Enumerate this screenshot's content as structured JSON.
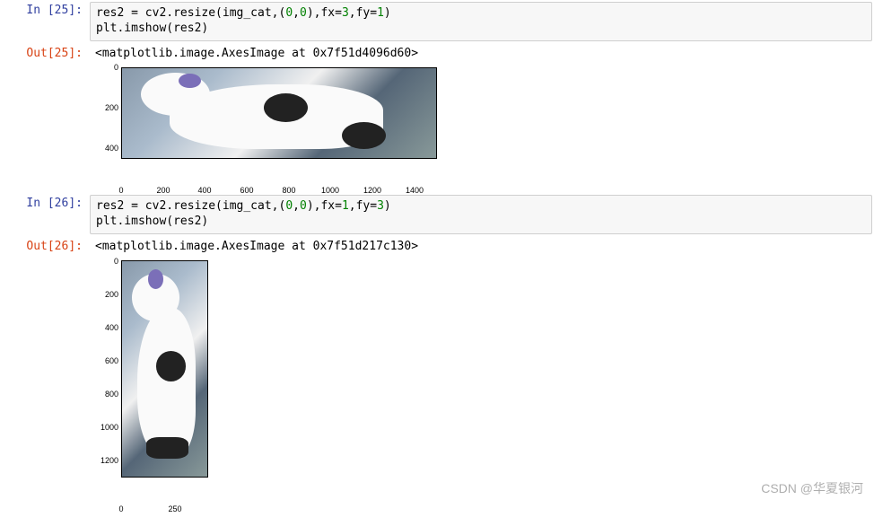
{
  "cells": {
    "c25": {
      "in_prompt": "In [25]:",
      "code_line1_prefix": "res2 = cv2.resize(img_cat,(",
      "code_line1_z1": "0",
      "code_line1_c1": ",",
      "code_line1_z2": "0",
      "code_line1_c2": "),fx=",
      "code_line1_fx": "3",
      "code_line1_c3": ",fy=",
      "code_line1_fy": "1",
      "code_line1_end": ")",
      "code_line2": "plt.imshow(res2)",
      "out_prompt": "Out[25]:",
      "out_text": "<matplotlib.image.AxesImage at 0x7f51d4096d60>"
    },
    "c26": {
      "in_prompt": "In [26]:",
      "code_line1_prefix": "res2 = cv2.resize(img_cat,(",
      "code_line1_z1": "0",
      "code_line1_c1": ",",
      "code_line1_z2": "0",
      "code_line1_c2": "),fx=",
      "code_line1_fx": "1",
      "code_line1_c3": ",fy=",
      "code_line1_fy": "3",
      "code_line1_end": ")",
      "code_line2": "plt.imshow(res2)",
      "out_prompt": "Out[26]:",
      "out_text": "<matplotlib.image.AxesImage at 0x7f51d217c130>"
    }
  },
  "chart_data": [
    {
      "type": "image",
      "title": "",
      "xlim": [
        0,
        1500
      ],
      "ylim": [
        450,
        0
      ],
      "xticks": [
        0,
        200,
        400,
        600,
        800,
        1000,
        1200,
        1400
      ],
      "yticks": [
        0,
        200,
        400
      ],
      "description": "Horizontally stretched (fx=3, fy=1) cat image"
    },
    {
      "type": "image",
      "title": "",
      "xlim": [
        0,
        400
      ],
      "ylim": [
        1300,
        0
      ],
      "xticks": [
        0,
        250
      ],
      "yticks": [
        0,
        200,
        400,
        600,
        800,
        1000,
        1200
      ],
      "description": "Vertically stretched (fx=1, fy=3) cat image"
    }
  ],
  "watermark": "CSDN @华夏银河"
}
